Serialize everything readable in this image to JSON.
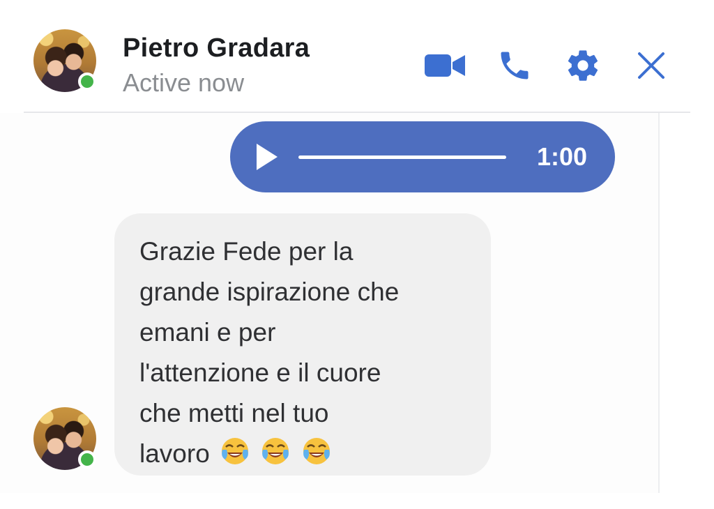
{
  "header": {
    "contact_name": "Pietro Gradara",
    "status": "Active now",
    "actions": [
      {
        "name": "video-call",
        "icon": "video-camera-icon"
      },
      {
        "name": "voice-call",
        "icon": "phone-icon"
      },
      {
        "name": "settings",
        "icon": "gear-icon"
      },
      {
        "name": "close",
        "icon": "close-icon"
      }
    ]
  },
  "messages": {
    "audio_message": {
      "duration": "1:00",
      "icon": "play-icon"
    },
    "text_message": {
      "lines": [
        "Grazie Fede per la",
        "grande ispirazione che",
        "emani e per",
        "l'attenzione e il cuore",
        "che metti nel tuo",
        "lavoro"
      ],
      "emoji": [
        "😂",
        "😂",
        "😂"
      ]
    }
  },
  "colors": {
    "accent": "#4e6ebf",
    "icon_blue": "#3c6fd1",
    "online": "#44b44a",
    "incoming_bubble": "#f0f0f0",
    "status_text": "#8a8d91"
  }
}
